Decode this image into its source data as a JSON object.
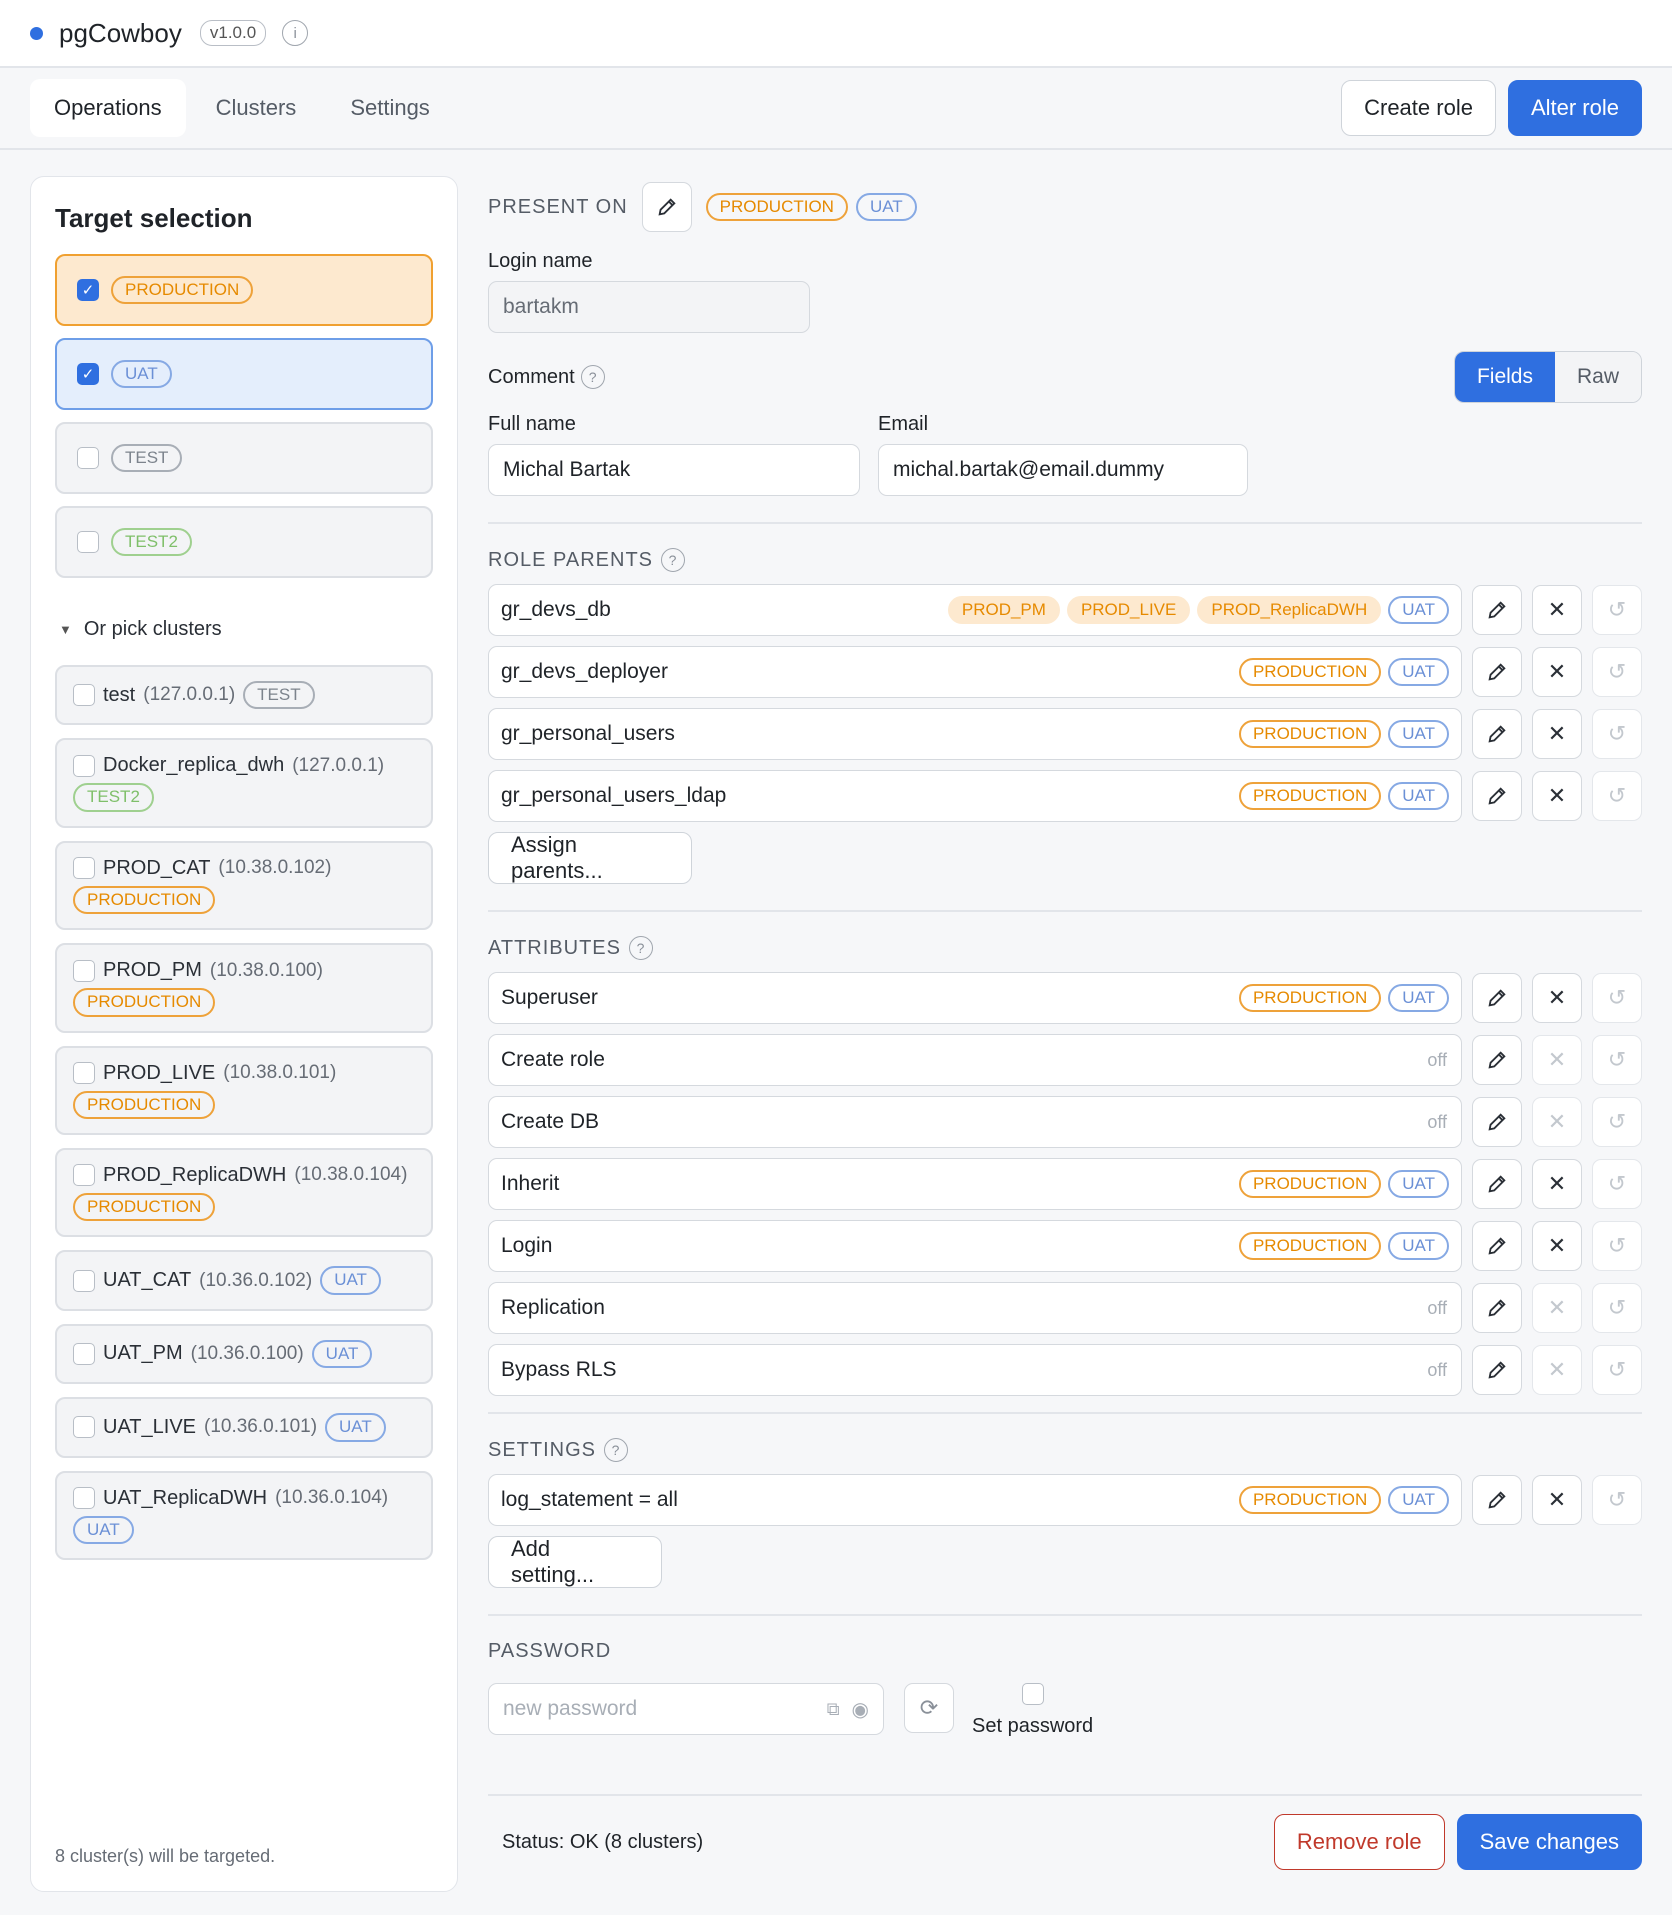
{
  "app": {
    "title": "pgCowboy",
    "version": "v1.0.0"
  },
  "nav": {
    "tabs": [
      "Operations",
      "Clusters",
      "Settings"
    ],
    "create_role": "Create role",
    "alter_role": "Alter role"
  },
  "sidebar": {
    "title": "Target selection",
    "envs": [
      {
        "label": "PRODUCTION",
        "checked": true
      },
      {
        "label": "UAT",
        "checked": true
      },
      {
        "label": "TEST",
        "checked": false
      },
      {
        "label": "TEST2",
        "checked": false
      }
    ],
    "pick_label": "Or pick clusters",
    "clusters": [
      {
        "name": "test",
        "ip": "(127.0.0.1)",
        "env": "TEST"
      },
      {
        "name": "Docker_replica_dwh",
        "ip": "(127.0.0.1)",
        "env": "TEST2"
      },
      {
        "name": "PROD_CAT",
        "ip": "(10.38.0.102)",
        "env": "PRODUCTION"
      },
      {
        "name": "PROD_PM",
        "ip": "(10.38.0.100)",
        "env": "PRODUCTION"
      },
      {
        "name": "PROD_LIVE",
        "ip": "(10.38.0.101)",
        "env": "PRODUCTION"
      },
      {
        "name": "PROD_ReplicaDWH",
        "ip": "(10.38.0.104)",
        "env": "PRODUCTION"
      },
      {
        "name": "UAT_CAT",
        "ip": "(10.36.0.102)",
        "env": "UAT"
      },
      {
        "name": "UAT_PM",
        "ip": "(10.36.0.100)",
        "env": "UAT"
      },
      {
        "name": "UAT_LIVE",
        "ip": "(10.36.0.101)",
        "env": "UAT"
      },
      {
        "name": "UAT_ReplicaDWH",
        "ip": "(10.36.0.104)",
        "env": "UAT"
      }
    ],
    "footer": "8 cluster(s) will be targeted."
  },
  "form": {
    "present_on_label": "PRESENT ON",
    "present_on": [
      "PRODUCTION",
      "UAT"
    ],
    "login_name_label": "Login name",
    "login_name": "bartakm",
    "comment_label": "Comment",
    "mode_fields": "Fields",
    "mode_raw": "Raw",
    "full_name_label": "Full name",
    "full_name": "Michal Bartak",
    "email_label": "Email",
    "email": "michal.bartak@email.dummy",
    "role_parents_label": "ROLE PARENTS",
    "parents": [
      {
        "name": "gr_devs_db",
        "tags": [
          "PROD_PM",
          "PROD_LIVE",
          "PROD_ReplicaDWH",
          "UAT"
        ]
      },
      {
        "name": "gr_devs_deployer",
        "tags": [
          "PRODUCTION",
          "UAT"
        ]
      },
      {
        "name": "gr_personal_users",
        "tags": [
          "PRODUCTION",
          "UAT"
        ]
      },
      {
        "name": "gr_personal_users_ldap",
        "tags": [
          "PRODUCTION",
          "UAT"
        ]
      }
    ],
    "assign_parents": "Assign parents...",
    "attributes_label": "ATTRIBUTES",
    "attributes": [
      {
        "name": "Superuser",
        "tags": [
          "PRODUCTION",
          "UAT"
        ]
      },
      {
        "name": "Create role",
        "off": "off"
      },
      {
        "name": "Create DB",
        "off": "off"
      },
      {
        "name": "Inherit",
        "tags": [
          "PRODUCTION",
          "UAT"
        ]
      },
      {
        "name": "Login",
        "tags": [
          "PRODUCTION",
          "UAT"
        ]
      },
      {
        "name": "Replication",
        "off": "off"
      },
      {
        "name": "Bypass RLS",
        "off": "off"
      }
    ],
    "settings_label": "SETTINGS",
    "settings": [
      {
        "name": "log_statement = all",
        "tags": [
          "PRODUCTION",
          "UAT"
        ]
      }
    ],
    "add_setting": "Add setting...",
    "password_label": "PASSWORD",
    "password_placeholder": "new password",
    "set_password": "Set password",
    "status": "Status: OK (8 clusters)",
    "remove_role": "Remove role",
    "save_changes": "Save changes"
  },
  "colors": {
    "accent": "#2f6fe0",
    "production": "#e68a00",
    "uat": "#6b90d6",
    "test": "#7c838c",
    "test2": "#7fbf6a",
    "danger": "#c0392b"
  }
}
